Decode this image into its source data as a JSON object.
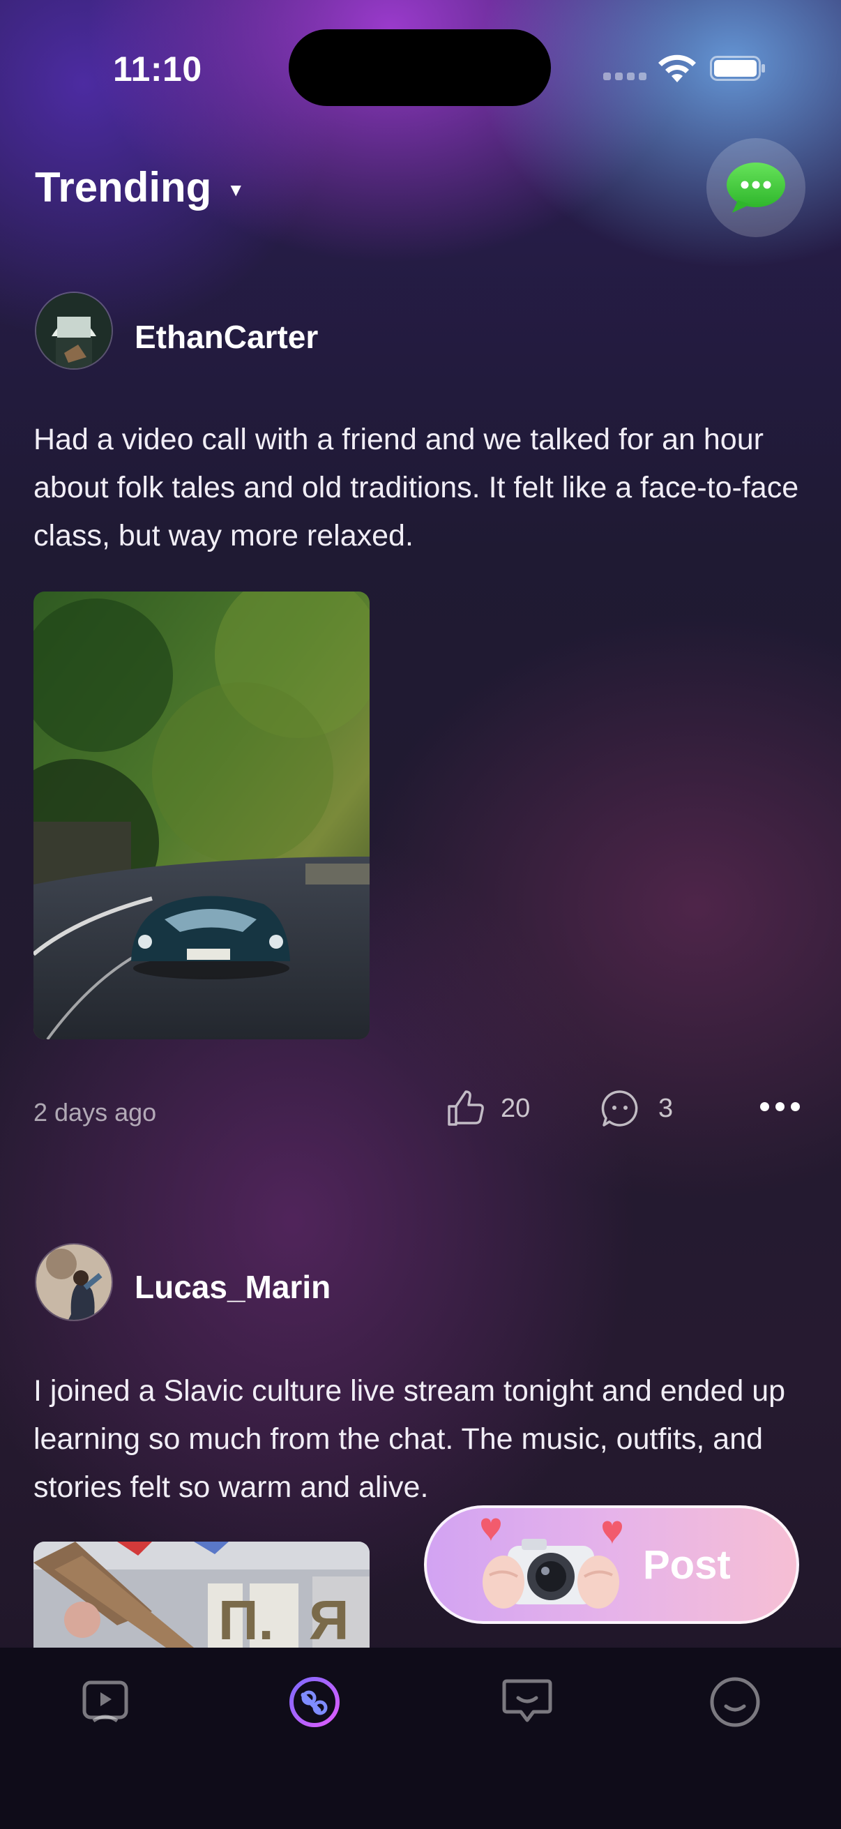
{
  "status_bar": {
    "time": "11:10"
  },
  "header": {
    "title": "Trending",
    "chat_icon": "message-bubble-icon"
  },
  "posts": [
    {
      "username": "EthanCarter",
      "text": "Had a video call with a friend and we talked for an hour about folk tales and old traditions. It felt like a face-to-face class, but way more relaxed.",
      "timestamp": "2 days ago",
      "likes": "20",
      "comments": "3"
    },
    {
      "username": "Lucas_Marin",
      "text": "I joined a Slavic culture live stream tonight and ended up learning so much from the chat. The music, outfits, and stories felt so warm and alive."
    }
  ],
  "post_button": {
    "label": "Post"
  },
  "tabbar": {
    "items": [
      {
        "icon": "video-play-icon",
        "active": false
      },
      {
        "icon": "discover-icon",
        "active": true
      },
      {
        "icon": "chat-icon",
        "active": false
      },
      {
        "icon": "profile-icon",
        "active": false
      }
    ]
  },
  "colors": {
    "accent_start": "#7f6bff",
    "accent_end": "#e05cff",
    "chat_green": "#3dc93a"
  }
}
